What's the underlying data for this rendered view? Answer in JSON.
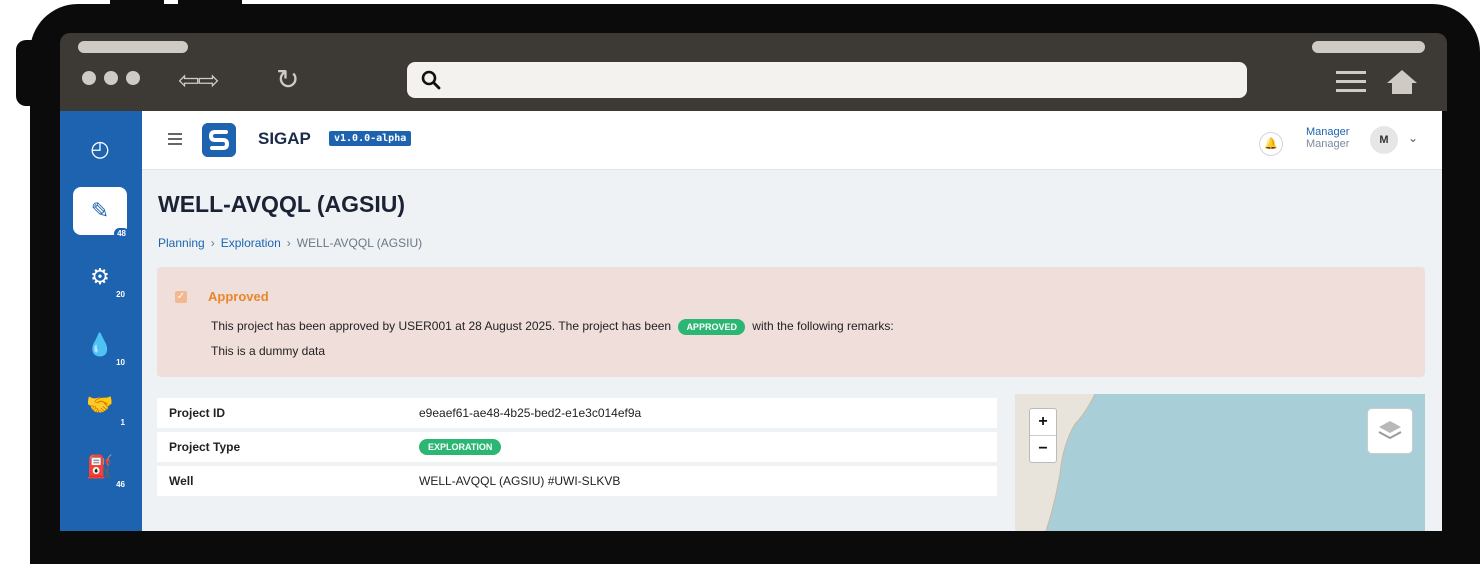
{
  "app": {
    "brand": "SIGAP",
    "version": "v1.0.0-alpha"
  },
  "user": {
    "name": "Manager",
    "role": "Manager",
    "avatar_initial": "M"
  },
  "sidebar": {
    "items": [
      {
        "icon": "gauge-icon",
        "badge": ""
      },
      {
        "icon": "document-edit-icon",
        "badge": "48",
        "active": true
      },
      {
        "icon": "gears-icon",
        "badge": "20"
      },
      {
        "icon": "droplet-icon",
        "badge": "10"
      },
      {
        "icon": "handshake-icon",
        "badge": "1"
      },
      {
        "icon": "oil-rig-icon",
        "badge": "46"
      }
    ]
  },
  "page": {
    "title": "WELL-AVQQL (AGSIU)",
    "breadcrumb": [
      "Planning",
      "Exploration",
      "WELL-AVQQL (AGSIU)"
    ]
  },
  "alert": {
    "title": "Approved",
    "message_pre": "This project has been approved by USER001 at 28 August 2025. The project has been",
    "status_pill": "APPROVED",
    "message_post": "with the following remarks:",
    "remarks": "This is a dummy data"
  },
  "details": [
    {
      "label": "Project ID",
      "value": "e9eaef61-ae48-4b25-bed2-e1e3c014ef9a"
    },
    {
      "label": "Project Type",
      "tag": "EXPLORATION"
    },
    {
      "label": "Well",
      "value": "WELL-AVQQL (AGSIU) #UWI-SLKVB"
    }
  ],
  "map": {
    "zoom_in": "+",
    "zoom_out": "−"
  },
  "colors": {
    "primary": "#1e63b0",
    "approved_green": "#2bb673",
    "alert_bg": "#f0dedb",
    "alert_title": "#e8872c"
  }
}
